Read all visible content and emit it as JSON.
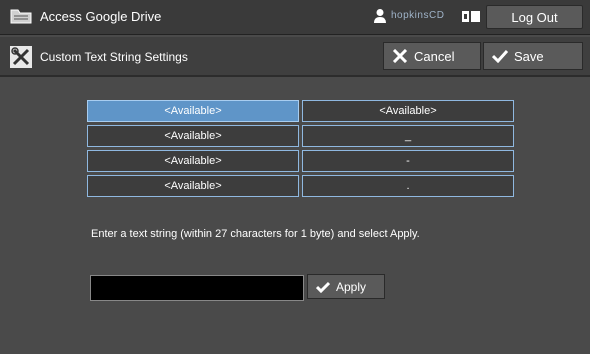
{
  "header": {
    "app_title": "Access Google Drive",
    "user_name": "hopkinsCD",
    "logout_label": "Log Out"
  },
  "titlebar": {
    "title": "Custom Text String Settings",
    "cancel_label": "Cancel",
    "save_label": "Save"
  },
  "grid": {
    "rows": [
      {
        "left": "<Available>",
        "right": "<Available>"
      },
      {
        "left": "<Available>",
        "right": "_"
      },
      {
        "left": "<Available>",
        "right": "-"
      },
      {
        "left": "<Available>",
        "right": "."
      }
    ]
  },
  "form": {
    "instructions": "Enter a text string (within 27 characters for 1 byte) and select Apply.",
    "input_value": "",
    "apply_label": "Apply"
  },
  "colors": {
    "selected_cell": "#5f95c8",
    "cell_border": "#8fb8e0",
    "background": "#4a4a4a"
  }
}
